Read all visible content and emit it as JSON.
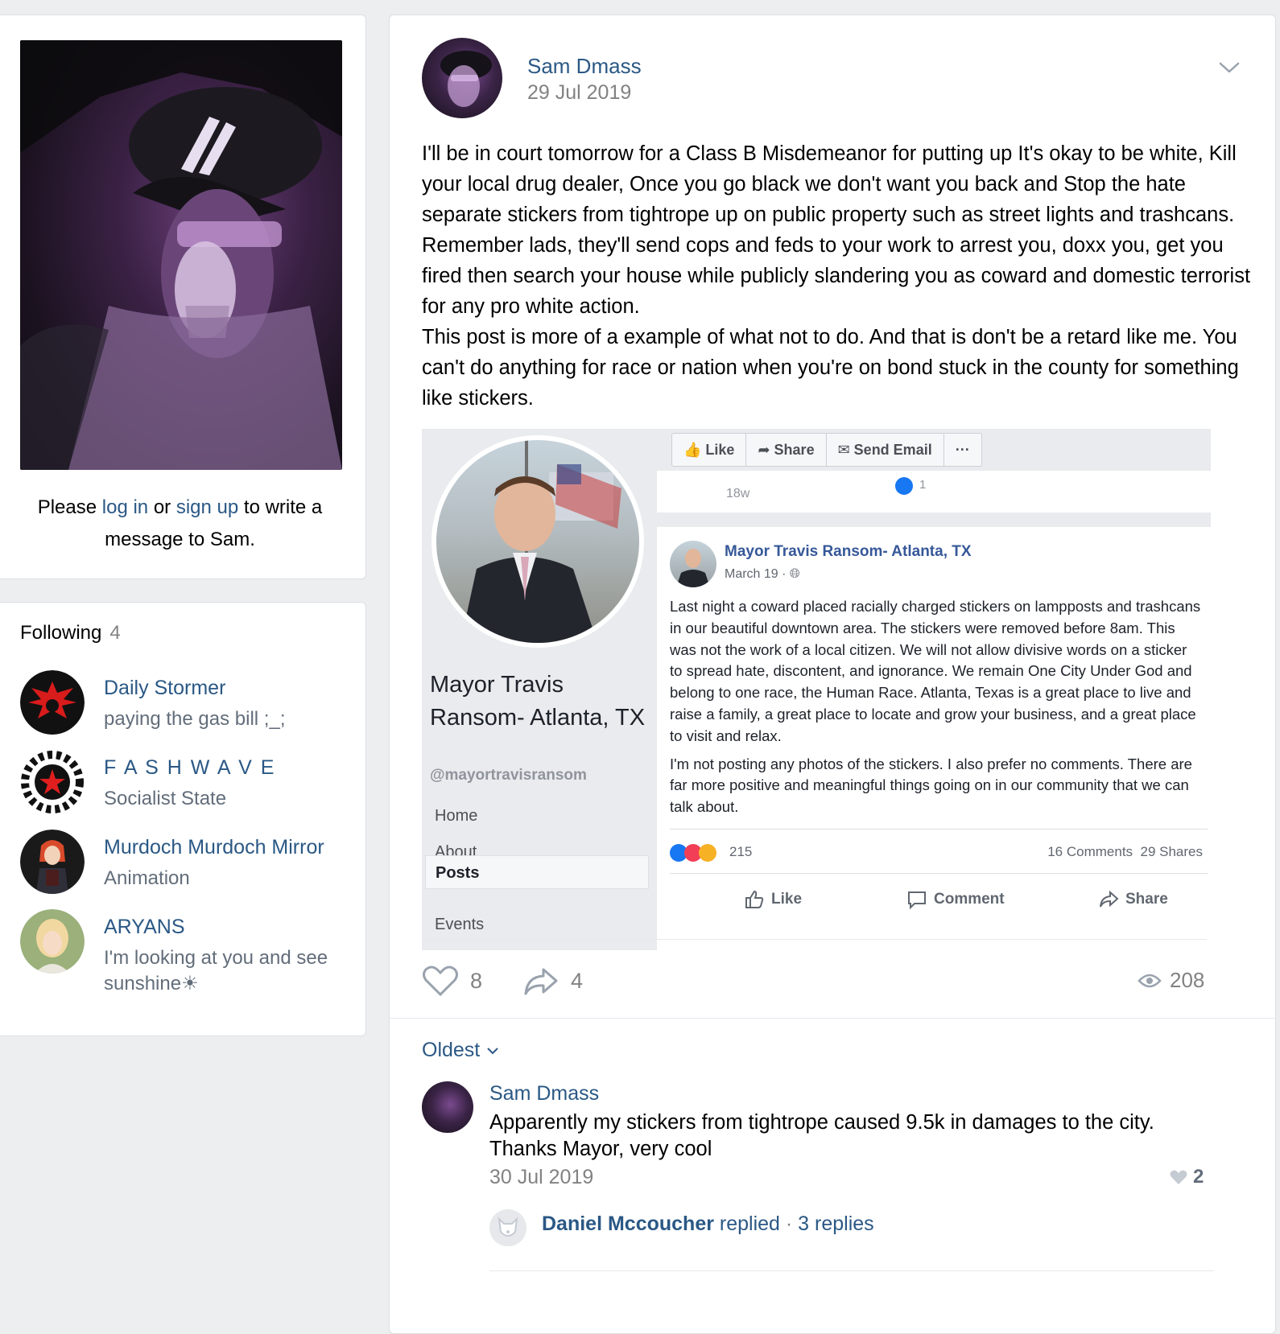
{
  "profile": {
    "write_prefix": "Please ",
    "login_link": "log in",
    "or_text": " or ",
    "signup_link": "sign up",
    "write_suffix": " to write a message to Sam."
  },
  "following": {
    "title": "Following",
    "count": "4",
    "items": [
      {
        "name": "Daily Stormer",
        "desc": "paying the gas bill ;_;"
      },
      {
        "name": "F A S H W A V E",
        "desc": "Socialist State"
      },
      {
        "name": "Murdoch Murdoch Mirror",
        "desc": "Animation"
      },
      {
        "name": "ARYANS",
        "desc": "I'm looking at you and see sunshine☀"
      }
    ]
  },
  "post": {
    "author": "Sam Dmass",
    "date": "29 Jul 2019",
    "text_p1": "I'll be in court tomorrow for a Class B Misdemeanor for putting up It's okay to be white, Kill your local drug dealer, Once you go black we don't want you back and Stop the hate separate stickers from tightrope up on public property such as street lights and trashcans. Remember lads, they'll send cops and feds to your work to arrest you, doxx you, get you fired then search your house while publicly slandering you as coward and domestic terrorist for any pro white action.",
    "text_p2": "This post is more of a example of what not to do. And that is don't be a retard like me. You can't do anything for race or nation when you're on bond stuck in the county for something like stickers.",
    "likes": "8",
    "shares": "4",
    "views": "208",
    "sort_label": "Oldest"
  },
  "embed": {
    "page_name": "Mayor Travis Ransom- Atlanta, TX",
    "handle": "@mayortravisransom",
    "nav": [
      "Home",
      "About",
      "Posts",
      "Events"
    ],
    "toolbar": [
      "Like",
      "Share",
      "Send Email",
      "···"
    ],
    "prev_time": "18w",
    "prev_likes": "1",
    "post_author": "Mayor Travis Ransom- Atlanta, TX",
    "post_date": "March 19 · ",
    "post_p1": "Last night a coward placed racially charged stickers on lampposts and trashcans in our beautiful downtown area. The stickers were removed before 8am. This was not the work of a local citizen. We will not allow divisive words on a sticker to spread hate, discontent, and ignorance. We remain One City Under God and belong to one race, the Human Race. Atlanta, Texas is a great place to live and raise a family, a great place to locate and grow your business, and a great place to visit and relax.",
    "post_p2": "I'm not posting any photos of the stickers. I also prefer no comments. There are far more positive and meaningful things going on in our community that we can talk about.",
    "reactions": "215",
    "comments": "16 Comments",
    "shares": "29 Shares",
    "action_like": "Like",
    "action_comment": "Comment",
    "action_share": "Share"
  },
  "comment": {
    "author": "Sam Dmass",
    "text": "Apparently my stickers from tightrope caused 9.5k in damages to the city. Thanks Mayor, very cool",
    "date": "30 Jul 2019",
    "likes": "2",
    "reply_name": "Daniel Mccoucher",
    "reply_verb": " replied",
    "reply_sep": " · ",
    "reply_count": "3 replies"
  }
}
